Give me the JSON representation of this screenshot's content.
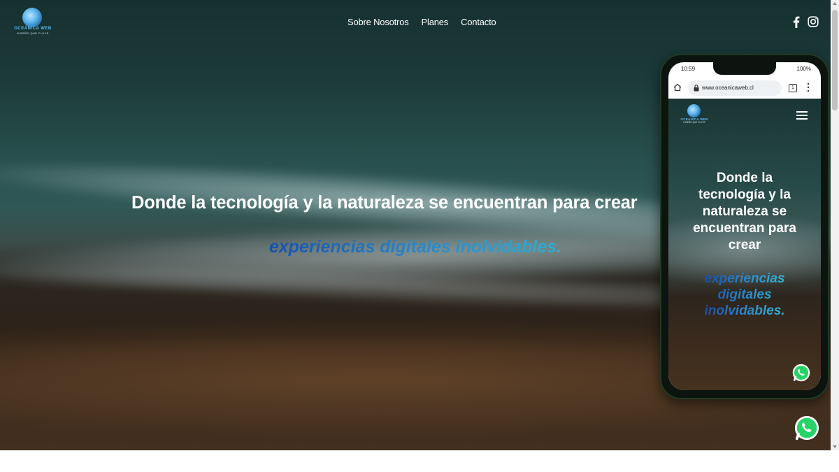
{
  "brand": {
    "name": "OCEÁNICA WEB",
    "tagline": "DISEÑO QUE FLUYE",
    "logo_icon": "wave-globe-icon"
  },
  "nav": {
    "items": [
      {
        "label": "Sobre Nosotros"
      },
      {
        "label": "Planes"
      },
      {
        "label": "Contacto"
      }
    ]
  },
  "social": {
    "facebook_icon": "facebook-icon",
    "instagram_icon": "instagram-icon"
  },
  "hero": {
    "title": "Donde la tecnología y la naturaleza se encuentran para crear",
    "subtitle": "experiencias digitales inolvidables."
  },
  "phone": {
    "status_time": "10:59",
    "status_right": "100%",
    "url": "www.oceanicaweb.cl",
    "tab_count": "1",
    "title": "Donde la tecnología y la naturaleza se encuentran para crear",
    "subtitle": "experiencias digitales inolvidables."
  },
  "whatsapp": {
    "icon": "whatsapp-icon"
  },
  "colors": {
    "accent_blue": "#1549a8",
    "accent_cyan": "#2fb4d4",
    "whatsapp_green": "#25d366"
  }
}
